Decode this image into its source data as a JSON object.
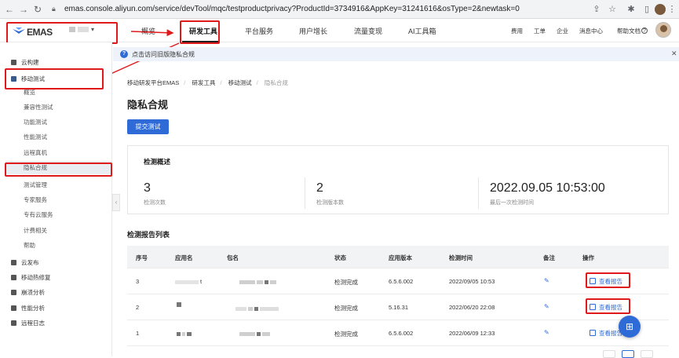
{
  "browser": {
    "url": "emas.console.aliyun.com/service/devTool/mqc/testproductprivacy?ProductId=3734916&AppKey=31241616&osType=2&newtask=0"
  },
  "topnav": {
    "logo": "EMAS",
    "menu": [
      "概览",
      "研发工具",
      "平台服务",
      "用户增长",
      "流量变现",
      "AI工具箱"
    ],
    "right": [
      "费用",
      "工单",
      "企业",
      "消息中心",
      "帮助文档"
    ]
  },
  "sidebar": {
    "items": [
      {
        "label": "云构建",
        "type": "group"
      },
      {
        "label": "移动测试",
        "type": "group"
      },
      {
        "label": "概览",
        "type": "sub"
      },
      {
        "label": "兼容性测试",
        "type": "sub"
      },
      {
        "label": "功能测试",
        "type": "sub"
      },
      {
        "label": "性能测试",
        "type": "sub"
      },
      {
        "label": "远程真机",
        "type": "sub"
      },
      {
        "label": "隐私合规",
        "type": "sub"
      },
      {
        "label": "测试管理",
        "type": "sub"
      },
      {
        "label": "专家服务",
        "type": "sub"
      },
      {
        "label": "专有云服务",
        "type": "sub"
      },
      {
        "label": "计费相关",
        "type": "sub"
      },
      {
        "label": "帮助",
        "type": "sub"
      },
      {
        "label": "云发布",
        "type": "group"
      },
      {
        "label": "移动热修复",
        "type": "group"
      },
      {
        "label": "崩溃分析",
        "type": "group"
      },
      {
        "label": "性能分析",
        "type": "group"
      },
      {
        "label": "远程日志",
        "type": "group"
      }
    ]
  },
  "notice": {
    "text": "点击访问旧版隐私合规"
  },
  "breadcrumb": [
    "移动研发平台EMAS",
    "研发工具",
    "移动测试",
    "隐私合规"
  ],
  "page": {
    "title": "隐私合规",
    "submit_label": "提交测试"
  },
  "overview": {
    "title": "检测概述",
    "stats": [
      {
        "value": "3",
        "label": "检测次数"
      },
      {
        "value": "2",
        "label": "检测版本数"
      },
      {
        "value": "2022.09.05 10:53:00",
        "label": "最后一次检测时间"
      }
    ]
  },
  "report_list": {
    "title": "检测报告列表",
    "columns": [
      "序号",
      "应用名",
      "包名",
      "状态",
      "应用版本",
      "检测时间",
      "备注",
      "操作"
    ],
    "rows": [
      {
        "index": "3",
        "app_name_suffix": "t",
        "status": "检测完成",
        "version": "6.5.6.002",
        "time": "2022/09/05 10:53",
        "action": "查看报告"
      },
      {
        "index": "2",
        "status": "检测完成",
        "version": "5.16.31",
        "time": "2022/06/20 22:08",
        "action": "查看报告"
      },
      {
        "index": "1",
        "status": "检测完成",
        "version": "6.5.6.002",
        "time": "2022/06/09 12:33",
        "action": "查看报告"
      }
    ]
  },
  "colors": {
    "accent": "#2f6bd6",
    "highlight": "#e0191b"
  }
}
